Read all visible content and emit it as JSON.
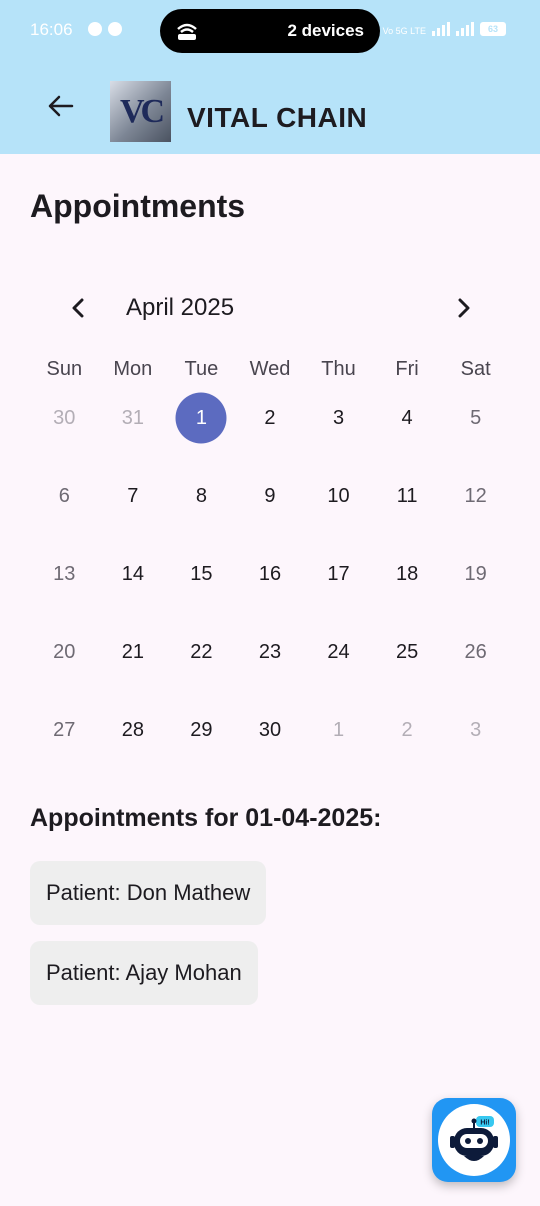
{
  "status": {
    "time": "16:06",
    "pill_text": "2 devices",
    "network": "Vo 5G LTE",
    "battery": "63"
  },
  "appbar": {
    "title": "VITAL CHAIN",
    "logo_text": "VC"
  },
  "page": {
    "title": "Appointments"
  },
  "calendar": {
    "month_label": "April 2025",
    "weekdays": [
      "Sun",
      "Mon",
      "Tue",
      "Wed",
      "Thu",
      "Fri",
      "Sat"
    ],
    "weeks": [
      [
        "30",
        "31",
        "1",
        "2",
        "3",
        "4",
        "5"
      ],
      [
        "6",
        "7",
        "8",
        "9",
        "10",
        "11",
        "12"
      ],
      [
        "13",
        "14",
        "15",
        "16",
        "17",
        "18",
        "19"
      ],
      [
        "20",
        "21",
        "22",
        "23",
        "24",
        "25",
        "26"
      ],
      [
        "27",
        "28",
        "29",
        "30",
        "1",
        "2",
        "3"
      ]
    ],
    "selected_day": "1"
  },
  "appointments": {
    "heading": "Appointments for 01-04-2025:",
    "items": [
      {
        "label": "Patient: Don Mathew"
      },
      {
        "label": "Patient: Ajay Mohan"
      }
    ]
  },
  "fab": {
    "badge": "Hi!",
    "icon": "chatbot-icon",
    "color": "#2196f3"
  },
  "colors": {
    "appbar": "#b6e3f9",
    "selected": "#5c6bc0",
    "background": "#fdf6fc"
  }
}
